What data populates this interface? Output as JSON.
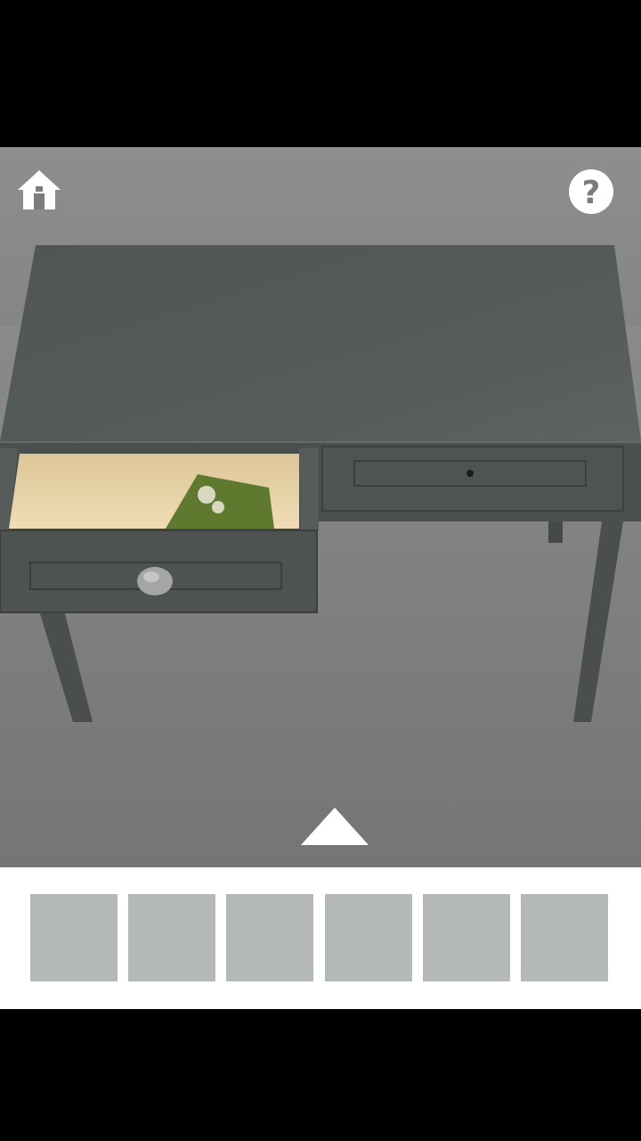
{
  "hud": {
    "home_icon": "home-icon",
    "help_icon": "question-mark-icon",
    "help_glyph": "?"
  },
  "navigation": {
    "up_icon": "up-triangle-icon"
  },
  "scene": {
    "description_icons": [
      "desk",
      "open-drawer",
      "closed-drawer",
      "green-card"
    ]
  },
  "inventory": {
    "slot_count": 6,
    "slot_color": "#b4b8b9"
  },
  "colors": {
    "letterbox": "#000000",
    "floor": "#7d7d7d",
    "wall": "#8c8c8c",
    "desk": "#4e5452",
    "drawer_inside": "#e8d2a8",
    "card": "#5f7a2e",
    "ui_white": "#ffffff"
  }
}
